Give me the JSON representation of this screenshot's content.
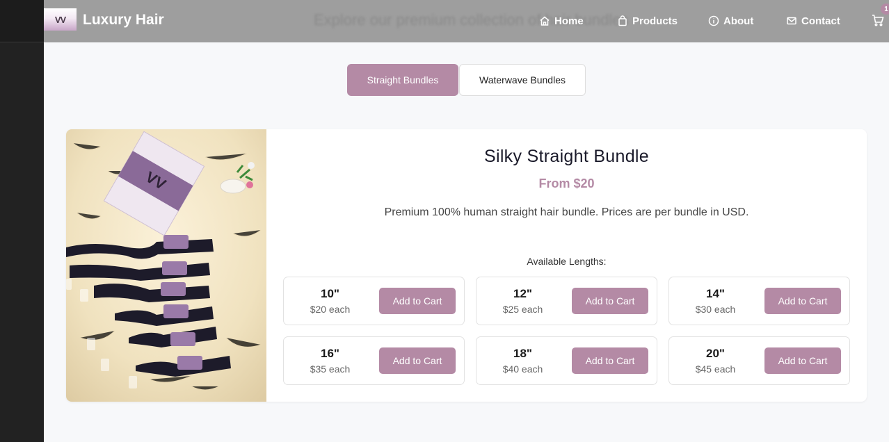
{
  "header": {
    "brand_logo": "VV",
    "brand_name": "Luxury Hair",
    "faded_banner": "Explore our premium collection of hair bundles",
    "nav": [
      {
        "label": "Home",
        "icon": "home-icon"
      },
      {
        "label": "Products",
        "icon": "bag-icon"
      },
      {
        "label": "About",
        "icon": "info-icon"
      },
      {
        "label": "Contact",
        "icon": "mail-icon"
      }
    ],
    "cart_count": "1"
  },
  "tabs": [
    {
      "label": "Straight Bundles",
      "active": true
    },
    {
      "label": "Waterwave Bundles",
      "active": false
    }
  ],
  "product": {
    "title": "Silky Straight Bundle",
    "price": "From $20",
    "description": "Premium 100% human straight hair bundle. Prices are per bundle in USD.",
    "lengths_label": "Available Lengths:",
    "lengths": [
      {
        "size": "10\"",
        "price": "$20 each",
        "button": "Add to Cart"
      },
      {
        "size": "12\"",
        "price": "$25 each",
        "button": "Add to Cart"
      },
      {
        "size": "14\"",
        "price": "$30 each",
        "button": "Add to Cart"
      },
      {
        "size": "16\"",
        "price": "$35 each",
        "button": "Add to Cart"
      },
      {
        "size": "18\"",
        "price": "$40 each",
        "button": "Add to Cart"
      },
      {
        "size": "20\"",
        "price": "$45 each",
        "button": "Add to Cart"
      }
    ],
    "photo_label": "VV"
  },
  "colors": {
    "accent": "#b48aa5",
    "navbar": "#9e9e9e",
    "page_bg": "#f7f8fa"
  }
}
